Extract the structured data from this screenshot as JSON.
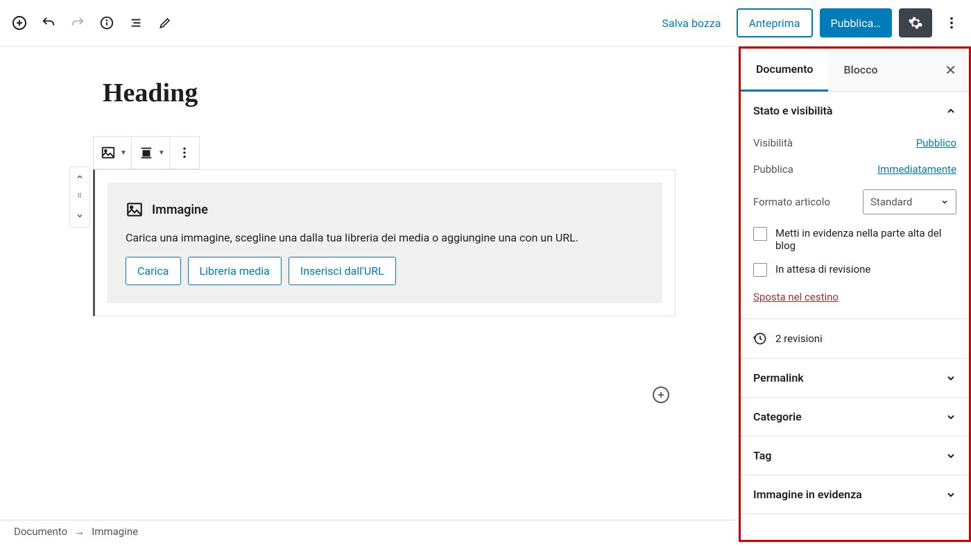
{
  "topbar": {
    "save_draft": "Salva bozza",
    "preview": "Anteprima",
    "publish": "Pubblica…"
  },
  "editor": {
    "heading": "Heading",
    "image_block": {
      "title": "Immagine",
      "desc": "Carica una immagine, scegline una dalla tua libreria dei media o aggiungine una con un URL.",
      "upload": "Carica",
      "media_library": "Libreria media",
      "from_url": "Inserisci dall'URL"
    }
  },
  "sidebar": {
    "tabs": {
      "document": "Documento",
      "block": "Blocco"
    },
    "status": {
      "title": "Stato e visibilità",
      "visibility_label": "Visibilità",
      "visibility_value": "Pubblico",
      "publish_label": "Pubblica",
      "publish_value": "Immediatamente",
      "format_label": "Formato articolo",
      "format_value": "Standard",
      "stick": "Metti in evidenza nella parte alta del blog",
      "pending": "In attesa di revisione",
      "trash": "Sposta nel cestino"
    },
    "revisions": "2 revisioni",
    "panels": {
      "permalink": "Permalink",
      "categories": "Categorie",
      "tags": "Tag",
      "featured": "Immagine in evidenza"
    }
  },
  "breadcrumb": {
    "doc": "Documento",
    "item": "Immagine"
  }
}
